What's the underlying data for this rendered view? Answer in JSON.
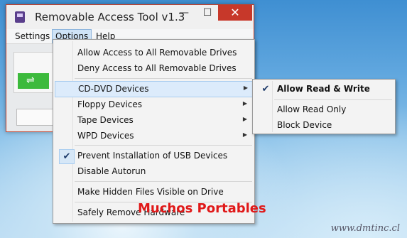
{
  "window": {
    "title": "Removable Access Tool v1.3",
    "controls": {
      "minimize": "—",
      "maximize": "☐",
      "close": "✕"
    }
  },
  "menubar": {
    "items": [
      {
        "label": "Settings"
      },
      {
        "label": "Options"
      },
      {
        "label": "Help"
      }
    ]
  },
  "options_menu": {
    "items": [
      {
        "label": "Allow Access to All Removable Drives"
      },
      {
        "label": "Deny Access to All Removable Drives"
      },
      {
        "label": "CD-DVD Devices",
        "submenu": true
      },
      {
        "label": "Floppy Devices",
        "submenu": true
      },
      {
        "label": "Tape Devices",
        "submenu": true
      },
      {
        "label": "WPD Devices",
        "submenu": true
      },
      {
        "label": "Prevent Installation of USB Devices",
        "checked": true
      },
      {
        "label": "Disable Autorun"
      },
      {
        "label": "Make Hidden Files Visible on Drive"
      },
      {
        "label": "Safely Remove Hardware"
      }
    ]
  },
  "cd_dvd_submenu": {
    "items": [
      {
        "label": "Allow Read & Write",
        "checked": true
      },
      {
        "label": "Allow Read Only"
      },
      {
        "label": "Block Device"
      }
    ]
  },
  "icons": {
    "app": "app-icon",
    "usb": "usb-drive-icon",
    "check": "checkmark-icon",
    "arrow": "submenu-arrow-icon"
  },
  "glyphs": {
    "check": "✔",
    "arrow": "▶"
  },
  "overlay": {
    "watermark": "Muchos Portables",
    "site": "www.dmtinc.cl"
  },
  "colors": {
    "close_button": "#c7382a",
    "highlight": "#dcebfb",
    "watermark": "#e01818"
  }
}
